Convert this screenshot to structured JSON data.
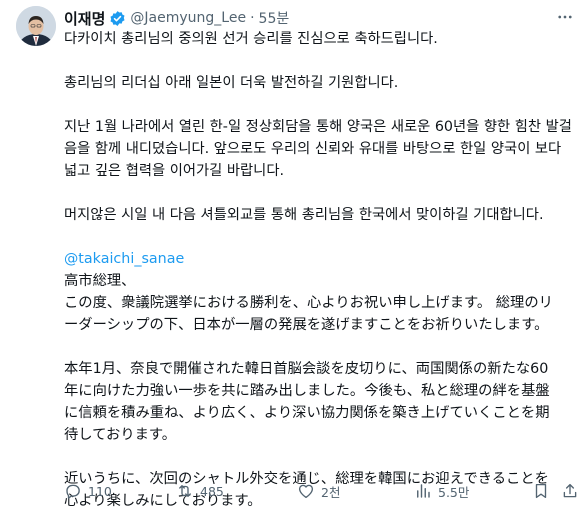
{
  "author": {
    "name": "이재명",
    "handle": "@Jaemyung_Lee",
    "separator": "·",
    "time": "55분",
    "verified": true
  },
  "body": {
    "lines": [
      "다카이치 총리님의 중의원 선거 승리를 진심으로 축하드립니다.",
      "",
      "총리님의 리더십 아래 일본이 더욱 발전하길 기원합니다.",
      "",
      "지난 1월 나라에서 열린 한-일 정상회담을 통해 양국은 새로운 60년을 향한 힘찬 발걸",
      "음을 함께 내디뎠습니다. 앞으로도 우리의 신뢰와 유대를 바탕으로 한일 양국이 보다",
      "넓고 깊은 협력을 이어가길 바랍니다.",
      "",
      "머지않은 시일 내 다음 셔틀외교를 통해 총리님을 한국에서 맞이하길 기대합니다.",
      "",
      "@takaichi_sanae",
      "高市総理、",
      "この度、衆議院選挙における勝利を、心よりお祝い申し上げます。 総理のリ",
      "ーダーシップの下、日本が一層の発展を遂げますことをお祈りいたします。",
      "",
      "本年1月、奈良で開催された韓日首脳会談を皮切りに、両国関係の新たな60",
      "年に向けた力強い一歩を共に踏み出しました。今後も、私と総理の絆を基盤",
      "に信頼を積み重ね、より広く、より深い協力関係を築き上げていくことを期",
      "待しております。",
      "",
      "近いうちに、次回のシャトル外交を通じ、総理を韓国にお迎えできることを",
      "心より楽しみにしております。"
    ],
    "mention_line_index": 10
  },
  "actions": {
    "reply": {
      "icon": "reply-icon",
      "count": "110"
    },
    "repost": {
      "icon": "repost-icon",
      "count": "485"
    },
    "like": {
      "icon": "like-icon",
      "count": "2천"
    },
    "views": {
      "icon": "views-icon",
      "count": "5.5만"
    },
    "bookmark": {
      "icon": "bookmark-icon"
    },
    "share": {
      "icon": "share-icon"
    }
  },
  "colors": {
    "text": "#0f1419",
    "secondary": "#536471",
    "link": "#1d9bf0",
    "verified": "#1d9bf0"
  }
}
